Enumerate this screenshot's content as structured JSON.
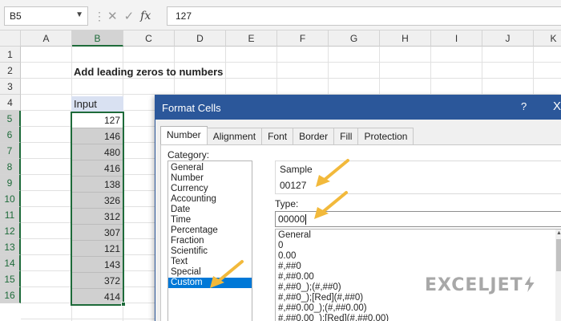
{
  "formula_bar": {
    "name_box": "B5",
    "cancel_icon": "cancel-icon",
    "confirm_icon": "check-icon",
    "fx_label": "fx",
    "formula_value": "127"
  },
  "columns": [
    "A",
    "B",
    "C",
    "D",
    "E",
    "F",
    "G",
    "H",
    "I",
    "J",
    "K"
  ],
  "rows": [
    "1",
    "2",
    "3",
    "4",
    "5",
    "6",
    "7",
    "8",
    "9",
    "10",
    "11",
    "12",
    "13",
    "14",
    "15",
    "16"
  ],
  "sheet": {
    "title": "Add leading zeros to numbers",
    "input_header": "Input",
    "input_values": [
      "127",
      "146",
      "480",
      "416",
      "138",
      "326",
      "312",
      "307",
      "121",
      "143",
      "372",
      "414"
    ]
  },
  "dialog": {
    "title": "Format Cells",
    "help": "?",
    "close": "X",
    "tabs": [
      "Number",
      "Alignment",
      "Font",
      "Border",
      "Fill",
      "Protection"
    ],
    "category_label": "Category:",
    "categories": [
      "General",
      "Number",
      "Currency",
      "Accounting",
      "Date",
      "Time",
      "Percentage",
      "Fraction",
      "Scientific",
      "Text",
      "Special",
      "Custom"
    ],
    "selected_category": "Custom",
    "sample_label": "Sample",
    "sample_value": "00127",
    "type_label": "Type:",
    "type_value": "00000",
    "format_list": [
      "General",
      "0",
      "0.00",
      "#,##0",
      "#,##0.00",
      "#,##0_);(#,##0)",
      "#,##0_);[Red](#,##0)",
      "#,##0.00_);(#,##0.00)",
      "#,##0.00_);[Red](#,##0.00)"
    ]
  },
  "watermark": "EXCELJET",
  "colors": {
    "accent": "#2b579a",
    "selection": "#1e6b3a",
    "arrow": "#f2b93b",
    "list_highlight": "#0078d7"
  }
}
